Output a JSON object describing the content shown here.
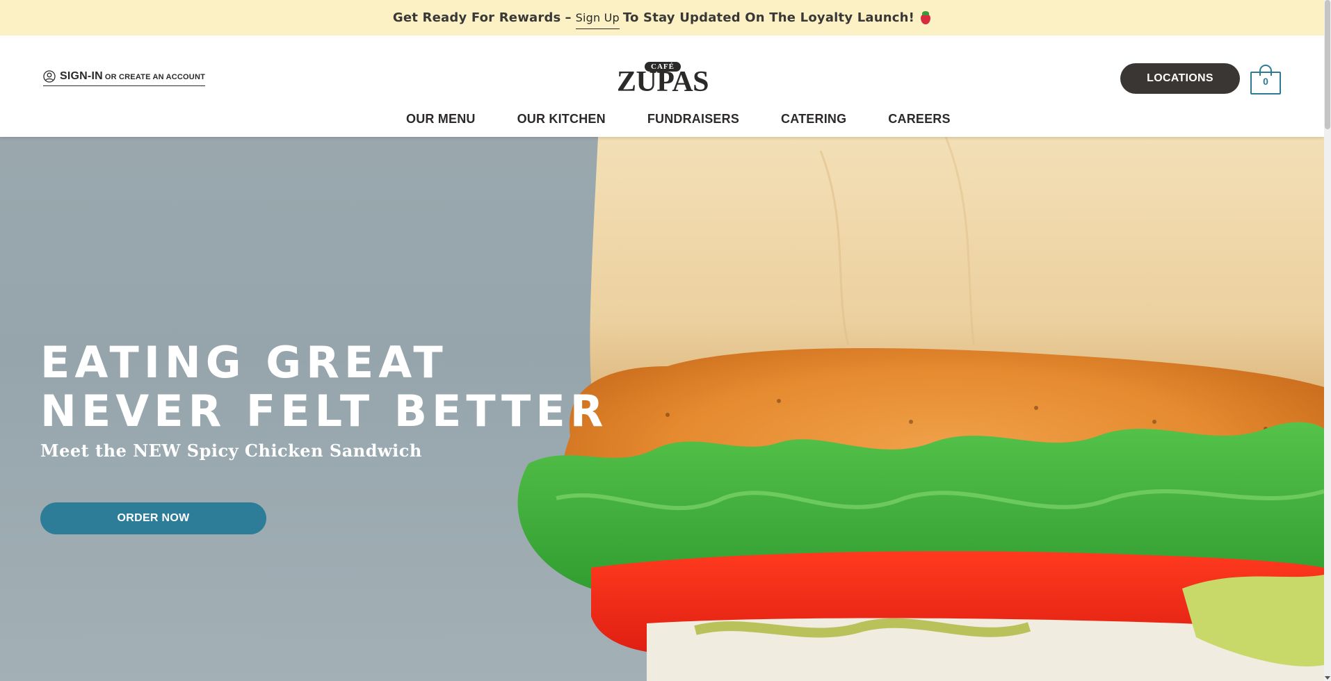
{
  "announcement": {
    "lead": "Get Ready For Rewards",
    "separator": "–",
    "signup_link": "Sign Up",
    "tail": "To Stay Updated On The Loyalty Launch!",
    "emoji_icon": "strawberry-icon"
  },
  "header": {
    "signin": {
      "icon": "user-circle-icon",
      "label": "SIGN-IN",
      "sub_label": "OR CREATE AN ACCOUNT"
    },
    "logo": {
      "badge": "CAFÉ",
      "wordmark": "ZUPAS"
    },
    "locations_label": "LOCATIONS",
    "cart": {
      "icon": "shopping-bag-icon",
      "count": "0"
    },
    "nav": [
      {
        "label": "OUR MENU"
      },
      {
        "label": "OUR KITCHEN"
      },
      {
        "label": "FUNDRAISERS"
      },
      {
        "label": "CATERING"
      },
      {
        "label": "CAREERS"
      }
    ]
  },
  "hero": {
    "title_line1": "EATING GREAT",
    "title_line2": "NEVER FELT BETTER",
    "subtitle": "Meet the NEW Spicy Chicken Sandwich",
    "cta_label": "ORDER NOW",
    "image": "spicy-chicken-sandwich-photo"
  },
  "colors": {
    "announcement_bg": "#fbf1c4",
    "dark": "#2c2a29",
    "accent_teal": "#2d7d99",
    "hero_bg": "#9aa8ae"
  }
}
